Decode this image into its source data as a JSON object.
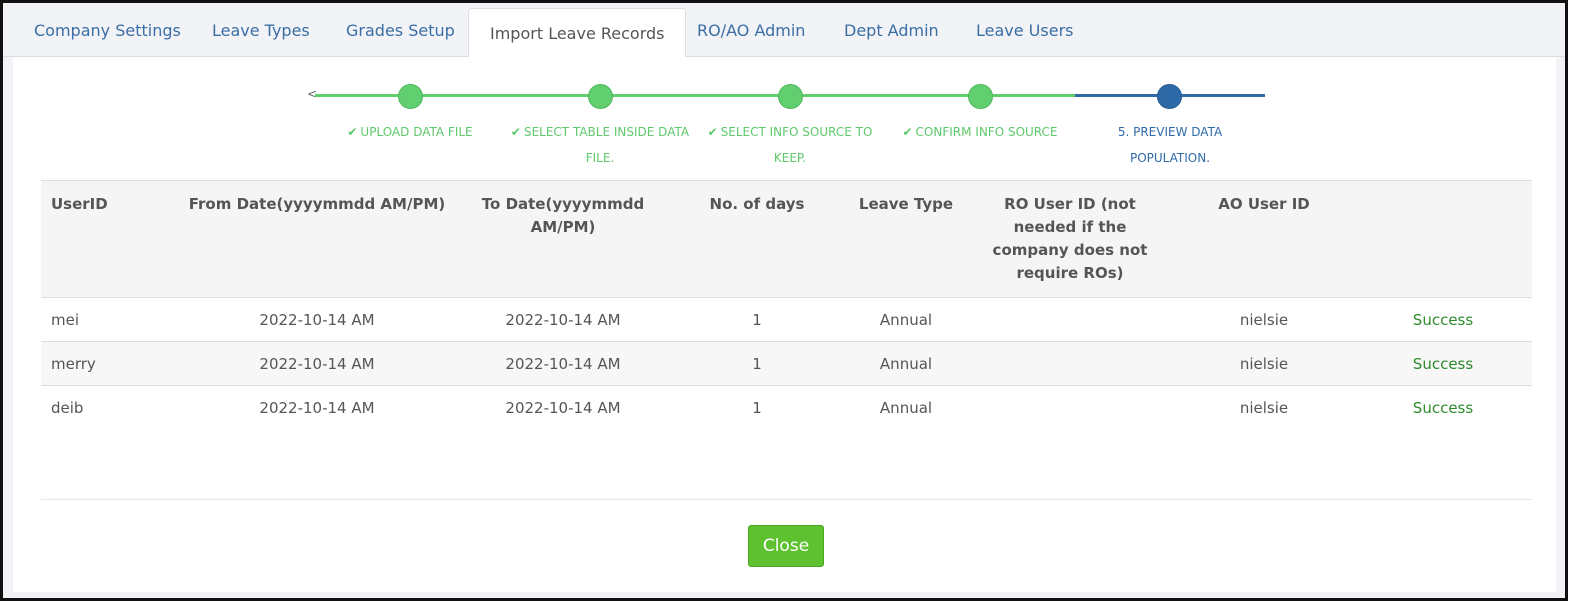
{
  "tabs": [
    {
      "label": "Company Settings"
    },
    {
      "label": "Leave Types"
    },
    {
      "label": "Grades Setup"
    },
    {
      "label": "Import Leave Records"
    },
    {
      "label": "RO/AO Admin"
    },
    {
      "label": "Dept Admin"
    },
    {
      "label": "Leave Users"
    }
  ],
  "active_tab": "Import Leave Records",
  "stepper": {
    "back_glyph": "<",
    "steps": [
      {
        "label": "UPLOAD DATA FILE",
        "line2": "",
        "done": true
      },
      {
        "label": "SELECT TABLE INSIDE DATA",
        "line2": "FILE.",
        "done": true
      },
      {
        "label": "SELECT INFO SOURCE TO",
        "line2": "KEEP.",
        "done": true
      },
      {
        "label": "CONFIRM INFO SOURCE",
        "line2": "",
        "done": true
      },
      {
        "label": "5. PREVIEW DATA",
        "line2": "POPULATION.",
        "done": false
      }
    ],
    "check_glyph": "✔"
  },
  "table": {
    "headers": [
      "UserID",
      "From Date(yyyymmdd AM/PM)",
      "To Date(yyyymmdd AM/PM)",
      "No. of days",
      "Leave Type",
      "RO User ID (not needed if the company does not require ROs)",
      "AO User ID",
      ""
    ],
    "rows": [
      {
        "user": "mei",
        "from": "2022-10-14 AM",
        "to": "2022-10-14 AM",
        "days": "1",
        "type": "Annual",
        "ro": "",
        "ao": "nielsie",
        "status": "Success"
      },
      {
        "user": "merry",
        "from": "2022-10-14 AM",
        "to": "2022-10-14 AM",
        "days": "1",
        "type": "Annual",
        "ro": "",
        "ao": "nielsie",
        "status": "Success"
      },
      {
        "user": "deib",
        "from": "2022-10-14 AM",
        "to": "2022-10-14 AM",
        "days": "1",
        "type": "Annual",
        "ro": "",
        "ao": "nielsie",
        "status": "Success"
      }
    ]
  },
  "close_label": "Close",
  "colors": {
    "tab_link": "#3a6ea5",
    "step_done": "#5fcf6d",
    "step_current": "#2e6aa8",
    "success": "#2d8a2d",
    "close_button": "#5ec12f"
  }
}
